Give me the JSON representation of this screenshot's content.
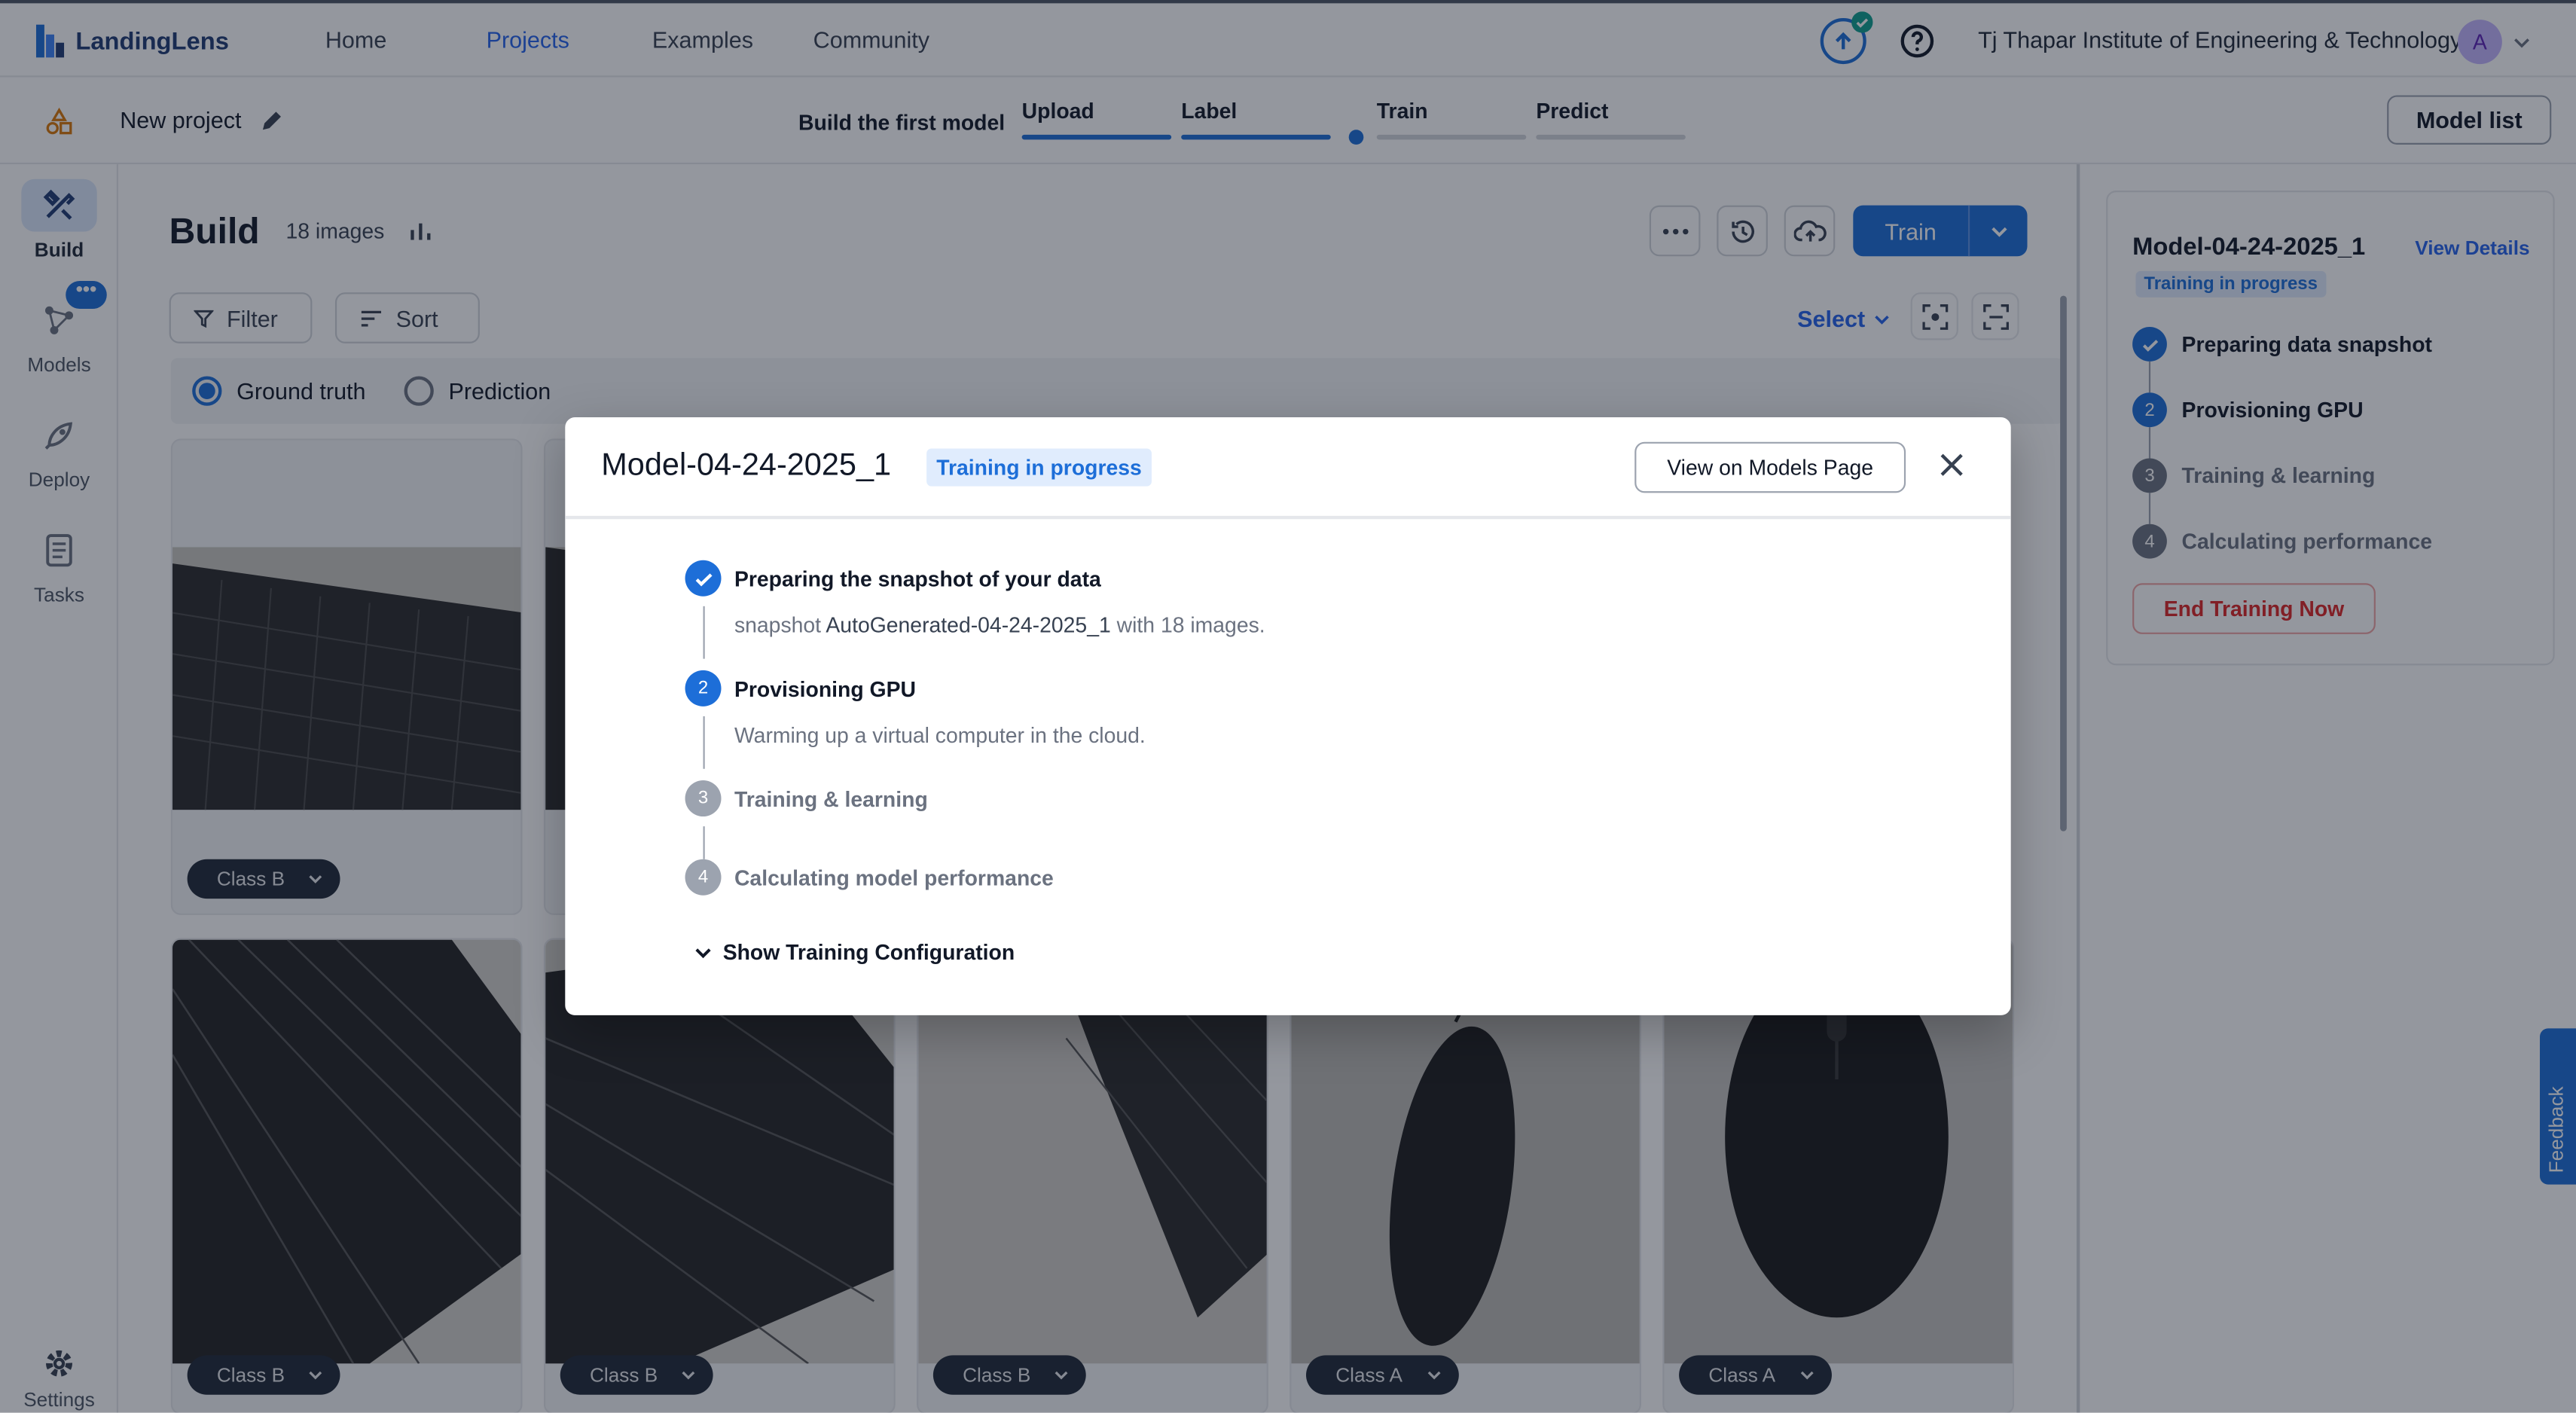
{
  "nav": {
    "logo_text": "LandingLens",
    "links": [
      "Home",
      "Projects",
      "Examples",
      "Community"
    ],
    "active_link": "Projects",
    "organization": "Tj Thapar Institute of Engineering & Technology",
    "avatar_initial": "A"
  },
  "project": {
    "name": "New project",
    "build_first_label": "Build the first model",
    "steps": [
      "Upload",
      "Label",
      "Train",
      "Predict"
    ],
    "model_list_label": "Model list"
  },
  "rail": {
    "items": [
      {
        "label": "Build",
        "icon": "build-tools-icon",
        "active": true
      },
      {
        "label": "Models",
        "icon": "models-graph-icon",
        "active": false
      },
      {
        "label": "Deploy",
        "icon": "rocket-icon",
        "active": false
      },
      {
        "label": "Tasks",
        "icon": "tasks-list-icon",
        "active": false
      }
    ],
    "settings_label": "Settings"
  },
  "build": {
    "title": "Build",
    "image_count": "18 images",
    "train_label": "Train",
    "filter_label": "Filter",
    "sort_label": "Sort",
    "select_label": "Select",
    "ground_truth_label": "Ground truth",
    "prediction_label": "Prediction"
  },
  "images": {
    "row1": [
      {
        "class": "Class B"
      }
    ],
    "row2": [
      {
        "class": "Class B"
      },
      {
        "class": "Class B"
      },
      {
        "class": "Class B"
      },
      {
        "class": "Class A"
      },
      {
        "class": "Class A"
      }
    ]
  },
  "right_panel": {
    "model_name": "Model-04-24-2025_1",
    "view_details_label": "View Details",
    "status_badge": "Training in progress",
    "steps": [
      {
        "num": "✓",
        "label": "Preparing data snapshot",
        "state": "done"
      },
      {
        "num": "2",
        "label": "Provisioning GPU",
        "state": "active"
      },
      {
        "num": "3",
        "label": "Training & learning",
        "state": "pending"
      },
      {
        "num": "4",
        "label": "Calculating performance",
        "state": "pending"
      }
    ],
    "end_training_label": "End Training Now"
  },
  "feedback_label": "Feedback",
  "modal": {
    "title": "Model-04-24-2025_1",
    "status_badge": "Training in progress",
    "view_models_label": "View on Models Page",
    "steps": [
      {
        "num": "✓",
        "label": "Preparing the snapshot of your data",
        "state": "done"
      },
      {
        "num": "2",
        "label": "Provisioning GPU",
        "state": "active"
      },
      {
        "num": "3",
        "label": "Training & learning",
        "state": "pending"
      },
      {
        "num": "4",
        "label": "Calculating model performance",
        "state": "pending"
      }
    ],
    "snapshot_prefix": "snapshot",
    "snapshot_name": "AutoGenerated-04-24-2025_1",
    "snapshot_suffix": "with 18 images.",
    "gpu_detail": "Warming up a virtual computer in the cloud.",
    "show_config_label": "Show Training Configuration"
  },
  "colors": {
    "accent": "#1d6ed8",
    "danger": "#dc2626",
    "badge_bg": "#e0ecfd"
  }
}
